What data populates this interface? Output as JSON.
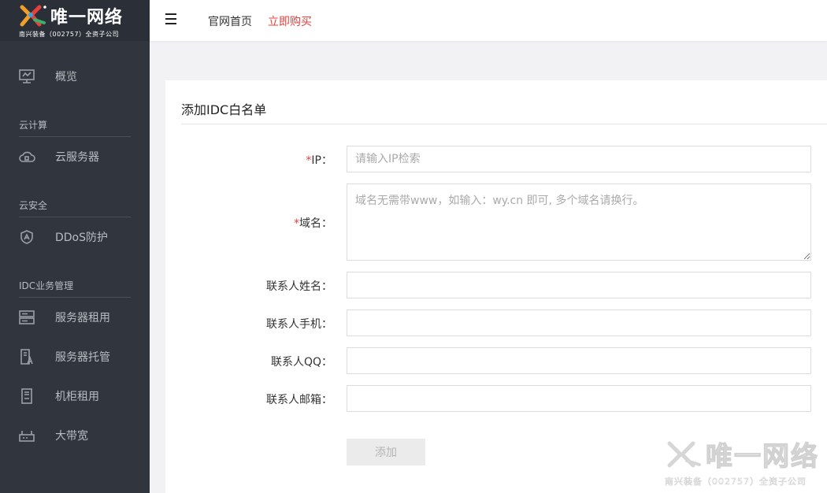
{
  "brand": {
    "name": "唯一网络",
    "subtitle": "南兴装备（002757）全资子公司"
  },
  "sidebar": {
    "overview": "概览",
    "sections": [
      {
        "title": "云计算",
        "items": [
          {
            "label": "云服务器",
            "icon": "cloud-server-icon"
          }
        ]
      },
      {
        "title": "云安全",
        "items": [
          {
            "label": "DDoS防护",
            "icon": "shield-icon"
          }
        ]
      },
      {
        "title": "IDC业务管理",
        "items": [
          {
            "label": "服务器租用",
            "icon": "server-icon"
          },
          {
            "label": "服务器托管",
            "icon": "server-hosting-icon"
          },
          {
            "label": "机柜租用",
            "icon": "cabinet-icon"
          },
          {
            "label": "大带宽",
            "icon": "router-icon"
          }
        ]
      }
    ]
  },
  "header": {
    "links": [
      "官网首页",
      "立即购买"
    ]
  },
  "form": {
    "title": "添加IDC白名单",
    "fields": {
      "ip": {
        "required_mark": "*",
        "label": "IP：",
        "placeholder": "请输入IP检索",
        "value": ""
      },
      "domain": {
        "required_mark": "*",
        "label": "域名：",
        "placeholder": "域名无需带www，如输入：wy.cn 即可, 多个域名请换行。",
        "value": ""
      },
      "contact_name": {
        "label": "联系人姓名：",
        "value": ""
      },
      "contact_phone": {
        "label": "联系人手机：",
        "value": ""
      },
      "contact_qq": {
        "label": "联系人QQ：",
        "value": ""
      },
      "contact_email": {
        "label": "联系人邮箱：",
        "value": ""
      }
    },
    "submit_label": "添加"
  },
  "colors": {
    "sidebar_bg": "#31363e",
    "accent_red": "#e8413c"
  }
}
